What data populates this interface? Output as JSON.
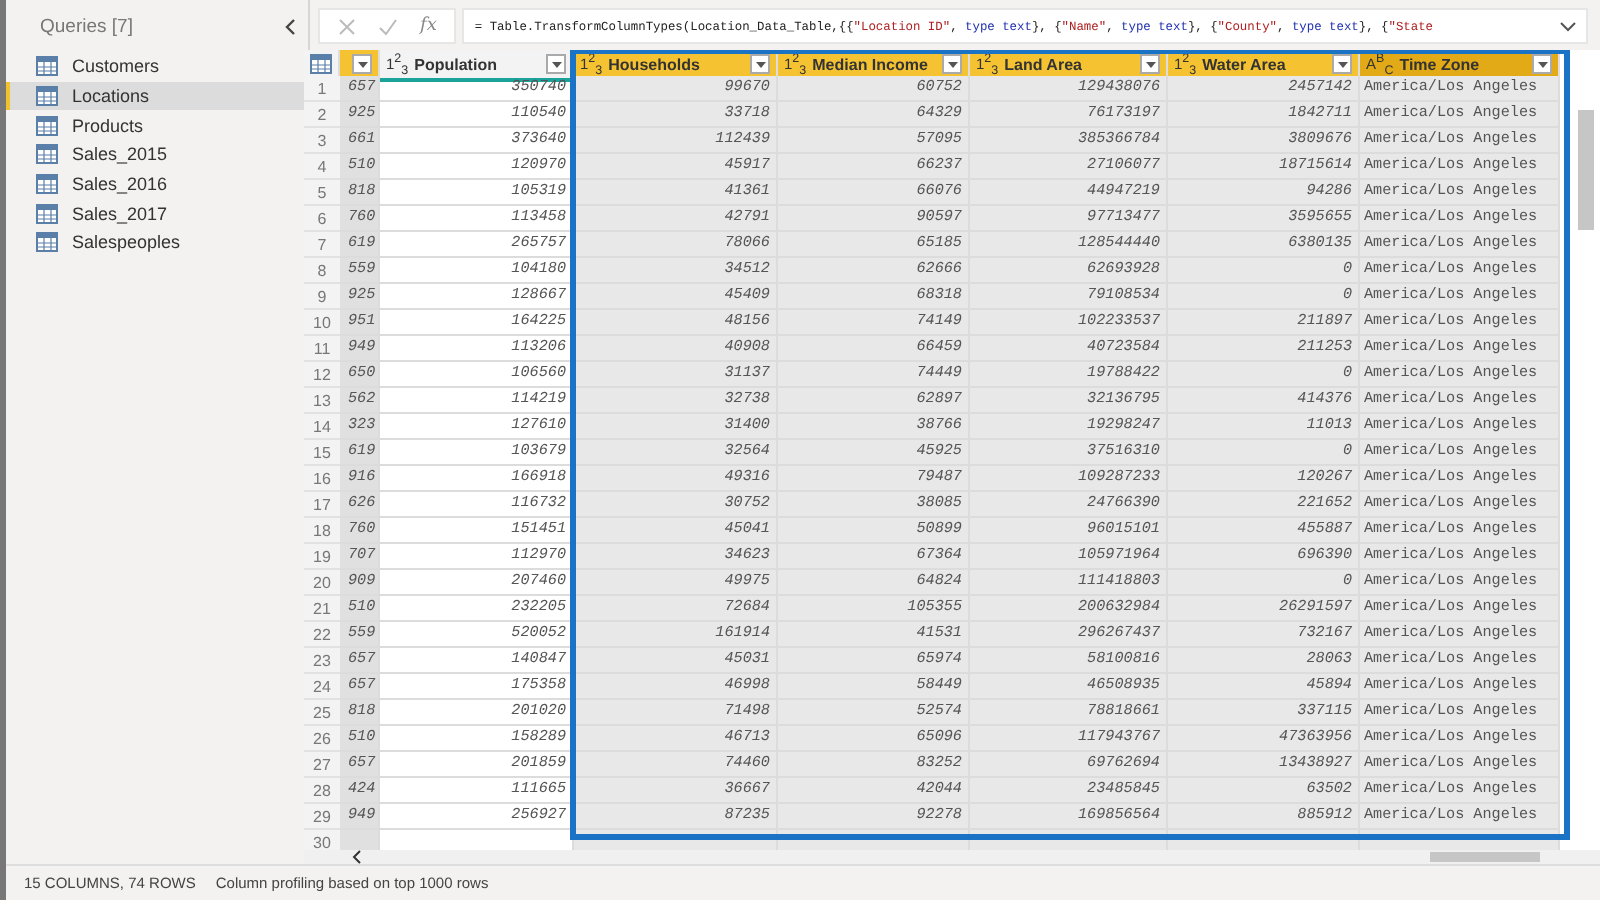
{
  "queries_panel": {
    "title": "Queries [7]",
    "items": [
      {
        "name": "Customers",
        "selected": false
      },
      {
        "name": "Locations",
        "selected": true
      },
      {
        "name": "Products",
        "selected": false
      },
      {
        "name": "Sales_2015",
        "selected": false
      },
      {
        "name": "Sales_2016",
        "selected": false
      },
      {
        "name": "Sales_2017",
        "selected": false
      },
      {
        "name": "Salespeoples",
        "selected": false
      }
    ]
  },
  "formula_bar": {
    "fx_label": "fx",
    "segments": [
      {
        "kind": "plain",
        "text": "= Table.TransformColumnTypes(Location_Data_Table,{{"
      },
      {
        "kind": "string",
        "text": "\"Location ID\""
      },
      {
        "kind": "plain",
        "text": ", "
      },
      {
        "kind": "keyword",
        "text": "type text"
      },
      {
        "kind": "plain",
        "text": "}, {"
      },
      {
        "kind": "string",
        "text": "\"Name\""
      },
      {
        "kind": "plain",
        "text": ", "
      },
      {
        "kind": "keyword",
        "text": "type text"
      },
      {
        "kind": "plain",
        "text": "}, {"
      },
      {
        "kind": "string",
        "text": "\"County\""
      },
      {
        "kind": "plain",
        "text": ", "
      },
      {
        "kind": "keyword",
        "text": "type text"
      },
      {
        "kind": "plain",
        "text": "}, {"
      },
      {
        "kind": "string",
        "text": "\"State"
      }
    ]
  },
  "table": {
    "columns": [
      {
        "selected": true,
        "current": false,
        "kind": "key"
      },
      {
        "type_icon": "1$^{2}$$_{3}$",
        "name": "Population",
        "selected": false,
        "current": false,
        "kind": "number"
      },
      {
        "type_icon": "1$^{2}$$_{3}$",
        "name": "Households",
        "selected": true,
        "current": false,
        "kind": "number"
      },
      {
        "type_icon": "1$^{2}$$_{3}$",
        "name": "Median Income",
        "selected": true,
        "current": false,
        "kind": "number"
      },
      {
        "type_icon": "1$^{2}$$_{3}$",
        "name": "Land Area",
        "selected": true,
        "current": false,
        "kind": "number"
      },
      {
        "type_icon": "1$^{2}$$_{3}$",
        "name": "Water Area",
        "selected": true,
        "current": false,
        "kind": "number"
      },
      {
        "type_icon": "A$^{B}$$_{C}$",
        "name": "Time Zone",
        "selected": true,
        "current": true,
        "kind": "text"
      }
    ],
    "rows": [
      {
        "n": "1",
        "cells": [
          "657",
          "350740",
          "99670",
          "60752",
          "129438076",
          "2457142",
          "America/Los Angeles"
        ]
      },
      {
        "n": "2",
        "cells": [
          "925",
          "110540",
          "33718",
          "64329",
          "76173197",
          "1842711",
          "America/Los Angeles"
        ]
      },
      {
        "n": "3",
        "cells": [
          "661",
          "373640",
          "112439",
          "57095",
          "385366784",
          "3809676",
          "America/Los Angeles"
        ]
      },
      {
        "n": "4",
        "cells": [
          "510",
          "120970",
          "45917",
          "66237",
          "27106077",
          "18715614",
          "America/Los Angeles"
        ]
      },
      {
        "n": "5",
        "cells": [
          "818",
          "105319",
          "41361",
          "66076",
          "44947219",
          "94286",
          "America/Los Angeles"
        ]
      },
      {
        "n": "6",
        "cells": [
          "760",
          "113458",
          "42791",
          "90597",
          "97713477",
          "3595655",
          "America/Los Angeles"
        ]
      },
      {
        "n": "7",
        "cells": [
          "619",
          "265757",
          "78066",
          "65185",
          "128544440",
          "6380135",
          "America/Los Angeles"
        ]
      },
      {
        "n": "8",
        "cells": [
          "559",
          "104180",
          "34512",
          "62666",
          "62693928",
          "0",
          "America/Los Angeles"
        ]
      },
      {
        "n": "9",
        "cells": [
          "925",
          "128667",
          "45409",
          "68318",
          "79108534",
          "0",
          "America/Los Angeles"
        ]
      },
      {
        "n": "10",
        "cells": [
          "951",
          "164225",
          "48156",
          "74149",
          "102233537",
          "211897",
          "America/Los Angeles"
        ]
      },
      {
        "n": "11",
        "cells": [
          "949",
          "113206",
          "40908",
          "66459",
          "40723584",
          "211253",
          "America/Los Angeles"
        ]
      },
      {
        "n": "12",
        "cells": [
          "650",
          "106560",
          "31137",
          "74449",
          "19788422",
          "0",
          "America/Los Angeles"
        ]
      },
      {
        "n": "13",
        "cells": [
          "562",
          "114219",
          "32738",
          "62897",
          "32136795",
          "414376",
          "America/Los Angeles"
        ]
      },
      {
        "n": "14",
        "cells": [
          "323",
          "127610",
          "31400",
          "38766",
          "19298247",
          "11013",
          "America/Los Angeles"
        ]
      },
      {
        "n": "15",
        "cells": [
          "619",
          "103679",
          "32564",
          "45925",
          "37516310",
          "0",
          "America/Los Angeles"
        ]
      },
      {
        "n": "16",
        "cells": [
          "916",
          "166918",
          "49316",
          "79487",
          "109287233",
          "120267",
          "America/Los Angeles"
        ]
      },
      {
        "n": "17",
        "cells": [
          "626",
          "116732",
          "30752",
          "38085",
          "24766390",
          "221652",
          "America/Los Angeles"
        ]
      },
      {
        "n": "18",
        "cells": [
          "760",
          "151451",
          "45041",
          "50899",
          "96015101",
          "455887",
          "America/Los Angeles"
        ]
      },
      {
        "n": "19",
        "cells": [
          "707",
          "112970",
          "34623",
          "67364",
          "105971964",
          "696390",
          "America/Los Angeles"
        ]
      },
      {
        "n": "20",
        "cells": [
          "909",
          "207460",
          "49975",
          "64824",
          "111418803",
          "0",
          "America/Los Angeles"
        ]
      },
      {
        "n": "21",
        "cells": [
          "510",
          "232205",
          "72684",
          "105355",
          "200632984",
          "26291597",
          "America/Los Angeles"
        ]
      },
      {
        "n": "22",
        "cells": [
          "559",
          "520052",
          "161914",
          "41531",
          "296267437",
          "732167",
          "America/Los Angeles"
        ]
      },
      {
        "n": "23",
        "cells": [
          "657",
          "140847",
          "45031",
          "65974",
          "58100816",
          "28063",
          "America/Los Angeles"
        ]
      },
      {
        "n": "24",
        "cells": [
          "657",
          "175358",
          "46998",
          "58449",
          "46508935",
          "45894",
          "America/Los Angeles"
        ]
      },
      {
        "n": "25",
        "cells": [
          "818",
          "201020",
          "71498",
          "52574",
          "78818661",
          "337115",
          "America/Los Angeles"
        ]
      },
      {
        "n": "26",
        "cells": [
          "510",
          "158289",
          "46713",
          "65096",
          "117943767",
          "47363956",
          "America/Los Angeles"
        ]
      },
      {
        "n": "27",
        "cells": [
          "657",
          "201859",
          "74460",
          "83252",
          "69762694",
          "13438927",
          "America/Los Angeles"
        ]
      },
      {
        "n": "28",
        "cells": [
          "424",
          "111665",
          "36667",
          "42044",
          "23485845",
          "63502",
          "America/Los Angeles"
        ]
      },
      {
        "n": "29",
        "cells": [
          "949",
          "256927",
          "87235",
          "92278",
          "169856564",
          "885912",
          "America/Los Angeles"
        ]
      }
    ],
    "partial_row": {
      "n": "30"
    }
  },
  "status_bar": {
    "counts": "15 COLUMNS, 74 ROWS",
    "profiling": "Column profiling based on top 1000 rows"
  }
}
